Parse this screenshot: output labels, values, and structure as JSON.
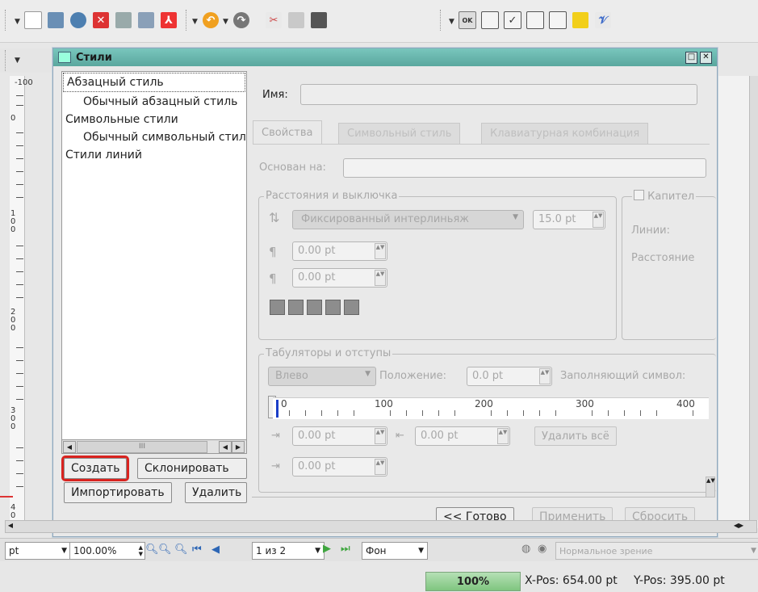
{
  "toolbar": {
    "icons": [
      "new-document-icon",
      "open-folder-icon",
      "revert-icon",
      "close-document-icon",
      "print-icon",
      "preflight-icon",
      "export-pdf-icon",
      "undo-icon",
      "redo-icon",
      "cut-icon",
      "copy-icon",
      "paste-icon",
      "ok-button-icon",
      "text-field-icon",
      "checkbox-icon",
      "list-box-icon",
      "combo-box-icon",
      "note-icon",
      "link-icon"
    ],
    "ok_label": "OK"
  },
  "left_ruler": {
    "labels": [
      "-100",
      "0",
      "1\n0\n0",
      "2\n0\n0",
      "3\n0\n0",
      "4\n0"
    ]
  },
  "dialog": {
    "title": "Стили",
    "tree": [
      {
        "label": "Абзацный стиль",
        "level": 0
      },
      {
        "label": "Обычный абзацный стиль",
        "level": 1
      },
      {
        "label": "Символьные стили",
        "level": 0
      },
      {
        "label": "Обычный символьный стиль",
        "level": 1
      },
      {
        "label": "Стили линий",
        "level": 0
      }
    ],
    "scroll_thumb": "III",
    "buttons": {
      "create": "Создать",
      "clone": "Склонировать",
      "import": "Импортировать",
      "delete": "Удалить"
    },
    "name_label": "Имя:",
    "tabs": [
      "Свойства",
      "Символьный стиль",
      "Клавиатурная комбинация"
    ],
    "based_on_label": "Основан на:",
    "spacing_group": "Расстояния и выключка",
    "line_spacing_mode": "Фиксированный интерлиньяж",
    "line_spacing_value": "15.0 pt",
    "space_above": "0.00 pt",
    "space_below": "0.00 pt",
    "caps_label": "Капител",
    "lines_label": "Линии:",
    "distance_label": "Расстояние",
    "tabs_group": "Табуляторы и отступы",
    "tab_align": "Влево",
    "position_label": "Положение:",
    "position_value": "0.0 pt",
    "fill_label": "Заполняющий символ:",
    "ruler_labels": [
      "0",
      "100",
      "200",
      "300",
      "400"
    ],
    "indent_first": "0.00 pt",
    "indent_left": "0.00 pt",
    "indent_right": "0.00 pt",
    "delete_all": "Удалить всё",
    "done": "<< Готово",
    "apply": "Применить",
    "reset": "Сбросить"
  },
  "bottom": {
    "unit": "pt",
    "zoom": "100.00%",
    "page": "1 из 2",
    "layer": "Фон",
    "view_mode": "Нормальное зрение"
  },
  "status": {
    "progress": "100%",
    "xpos": "X-Pos: 654.00 pt",
    "ypos": "Y-Pos: 395.00 pt"
  },
  "colors": {
    "title_bar": "#5aa79e",
    "highlight": "#d9231f",
    "progress": "#7fc57f"
  }
}
